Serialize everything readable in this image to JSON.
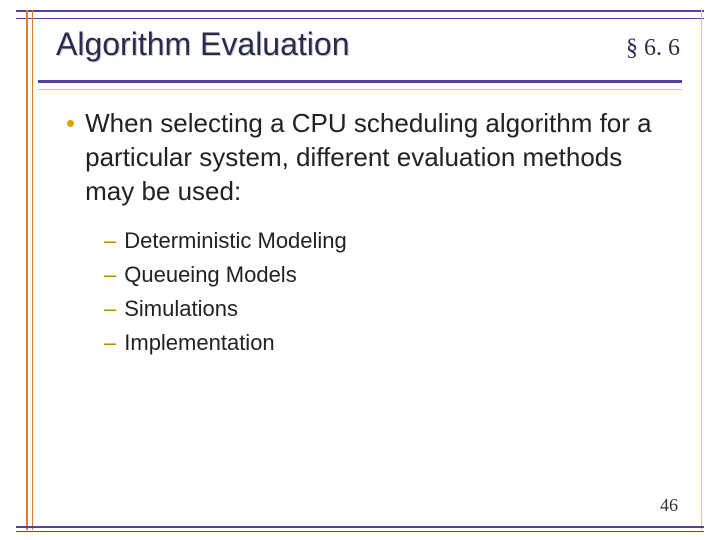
{
  "header": {
    "title": "Algorithm Evaluation",
    "section_ref": "§ 6. 6"
  },
  "body": {
    "bullet_main": "When selecting a CPU scheduling algorithm for a particular system, different evaluation methods may be used:",
    "sub_items": [
      "Deterministic Modeling",
      "Queueing Models",
      "Simulations",
      "Implementation"
    ]
  },
  "page_number": "46"
}
